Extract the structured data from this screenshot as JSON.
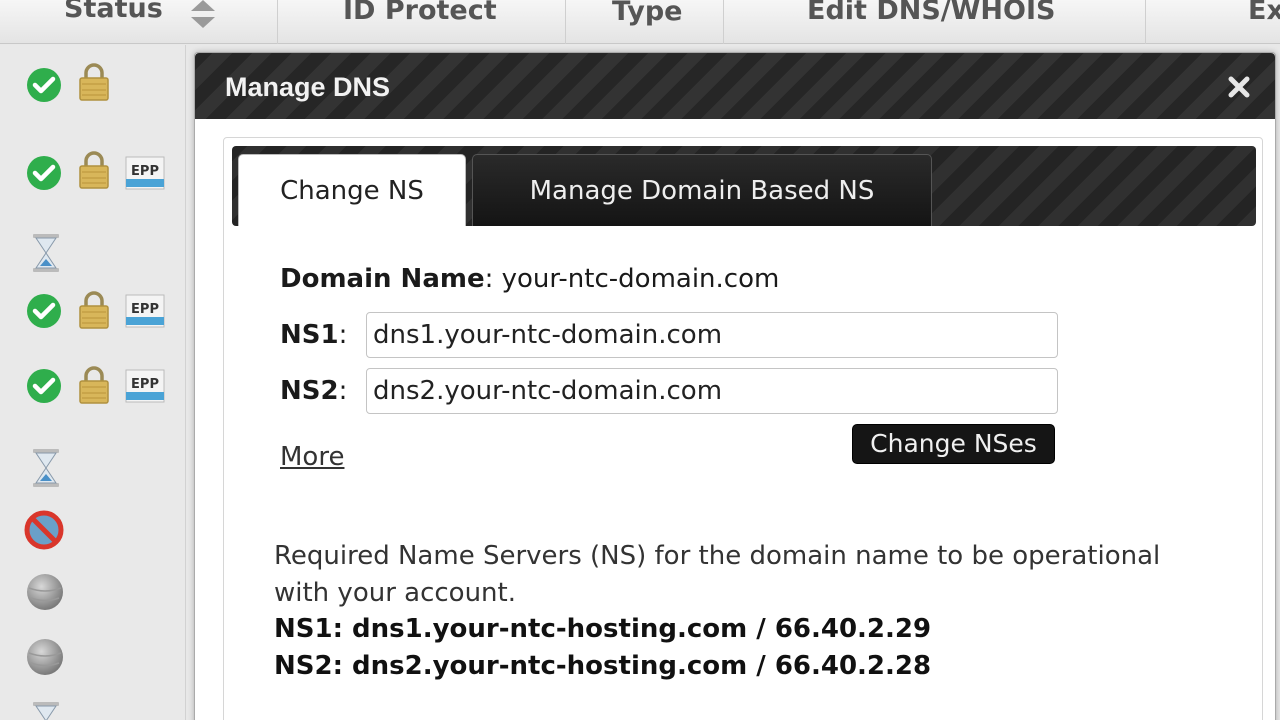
{
  "table_header": {
    "columns": [
      {
        "label": "Status"
      },
      {
        "label": "ID Protect"
      },
      {
        "label": "Type"
      },
      {
        "label": "Edit DNS/WHOIS"
      },
      {
        "label": "Ex"
      }
    ]
  },
  "status_rows": [
    {
      "icons": [
        "check-icon",
        "lock-icon"
      ]
    },
    {
      "icons": [
        "check-icon",
        "lock-icon",
        "epp-icon"
      ],
      "epp": "EPP"
    },
    {
      "icons": [
        "hourglass-icon"
      ]
    },
    {
      "icons": [
        "check-icon",
        "lock-icon",
        "epp-icon"
      ],
      "epp": "EPP"
    },
    {
      "icons": [
        "check-icon",
        "lock-icon",
        "epp-icon"
      ],
      "epp": "EPP"
    },
    {
      "icons": [
        "hourglass-icon"
      ]
    },
    {
      "icons": [
        "prohibited-icon"
      ]
    },
    {
      "icons": [
        "gray-globe-icon"
      ]
    },
    {
      "icons": [
        "gray-globe-icon"
      ]
    },
    {
      "icons": [
        "hourglass-icon"
      ]
    }
  ],
  "modal": {
    "title": "Manage DNS",
    "tabs": [
      {
        "label": "Change NS",
        "active": true
      },
      {
        "label": "Manage Domain Based NS",
        "active": false
      }
    ],
    "form": {
      "domain_label": "Domain Name",
      "domain_value": "your-ntc-domain.com",
      "ns1_label": "NS1",
      "ns1_value": "dns1.your-ntc-domain.com",
      "ns2_label": "NS2",
      "ns2_value": "dns2.your-ntc-domain.com",
      "colon": ":",
      "more_label": "More",
      "submit_label": "Change NSes"
    },
    "info": {
      "text": "Required Name Servers (NS) for the domain name to be operational with your account.",
      "ns1": "NS1: dns1.your-ntc-hosting.com / 66.40.2.29",
      "ns2": "NS2: dns2.your-ntc-hosting.com / 66.40.2.28"
    }
  },
  "colors": {
    "check_green": "#2fae4c",
    "lock_gold": "#d8b65a",
    "epp_blue": "#4aa3d6",
    "prohibited_red": "#d9362b"
  }
}
